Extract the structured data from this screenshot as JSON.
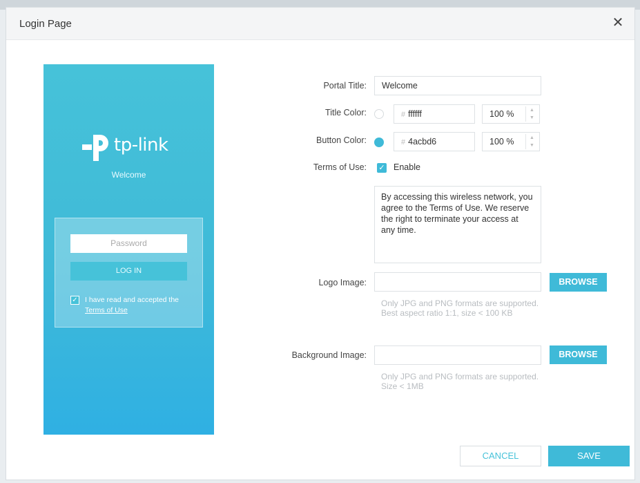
{
  "dialog": {
    "title": "Login Page",
    "close_label": "✕"
  },
  "preview": {
    "brand": "tp-link",
    "welcome": "Welcome",
    "password_placeholder": "Password",
    "login_label": "LOG IN",
    "tos_prefix": "I have read and accepted the",
    "tos_link": "Terms of Use"
  },
  "form": {
    "portal_title": {
      "label": "Portal Title:",
      "value": "Welcome"
    },
    "title_color": {
      "label": "Title Color:",
      "hex": "ffffff",
      "opacity": "100 %",
      "swatch": "#ffffff"
    },
    "button_color": {
      "label": "Button Color:",
      "hex": "4acbd6",
      "opacity": "100 %",
      "swatch": "#3fbad8"
    },
    "terms": {
      "label": "Terms of Use:",
      "enable_label": "Enable",
      "checked": true,
      "text": "By accessing this wireless network, you agree to the Terms of Use. We reserve the right to terminate your access at any time."
    },
    "logo_image": {
      "label": "Logo Image:",
      "value": "",
      "browse": "BROWSE",
      "hint": "Only JPG and PNG formats are supported. Best aspect ratio 1:1, size < 100 KB"
    },
    "background_image": {
      "label": "Background Image:",
      "value": "",
      "browse": "BROWSE",
      "hint": "Only JPG and PNG formats are supported. Size < 1MB"
    }
  },
  "footer": {
    "cancel": "CANCEL",
    "save": "SAVE"
  },
  "colors": {
    "accent": "#3fbad8",
    "preview_bg": "#46c2d9"
  }
}
